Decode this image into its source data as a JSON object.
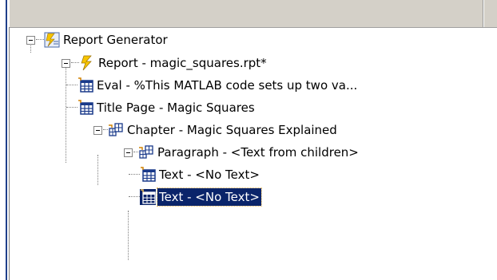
{
  "tree": {
    "items": [
      {
        "label": "Report Generator",
        "icon": "report-generator-icon"
      },
      {
        "label": "Report - magic_squares.rpt*",
        "icon": "lightning-report-icon"
      },
      {
        "label": "Eval - %This MATLAB code sets up two va...",
        "icon": "eval-table-icon"
      },
      {
        "label": "Title Page - Magic Squares",
        "icon": "title-page-table-icon"
      },
      {
        "label": "Chapter - Magic Squares Explained",
        "icon": "chapter-icon"
      },
      {
        "label": "Paragraph - <Text from children>",
        "icon": "paragraph-icon"
      },
      {
        "label": "Text - <No Text>",
        "icon": "text-table-icon"
      },
      {
        "label": "Text - <No Text>",
        "icon": "text-table-icon",
        "selected": true
      }
    ]
  },
  "colors": {
    "selection": "#0a246a",
    "toolbar": "#d4d0c8"
  }
}
